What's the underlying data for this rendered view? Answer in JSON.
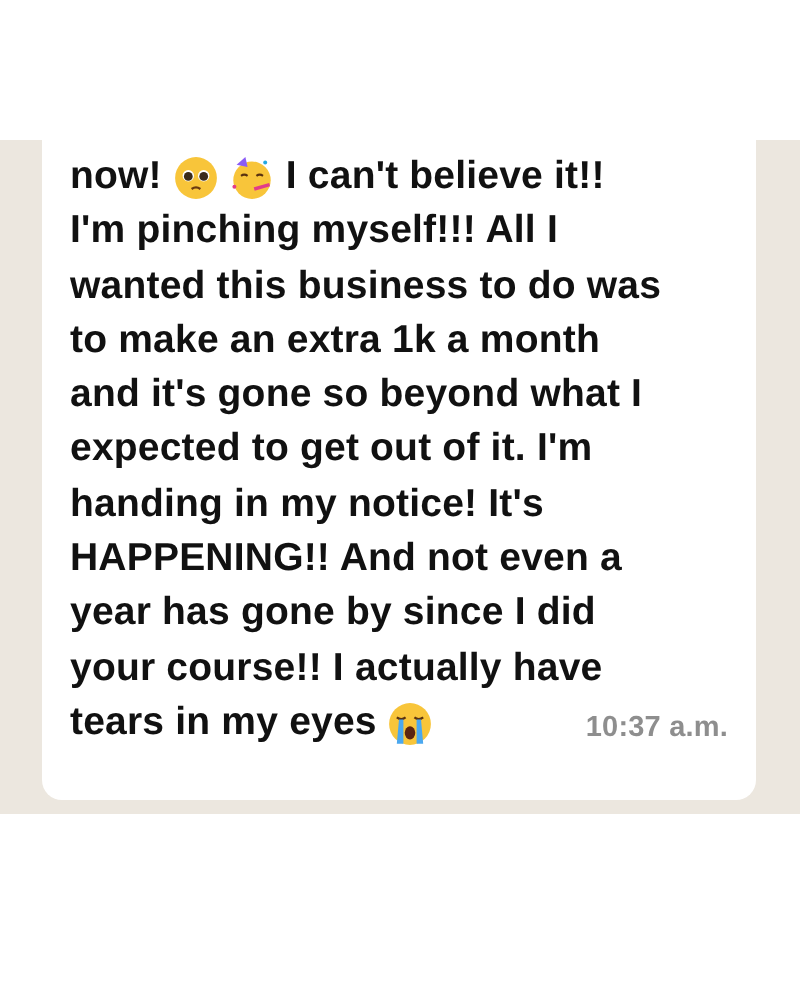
{
  "message": {
    "rows": [
      {
        "segments": [
          {
            "kind": "text",
            "lines": [
              "now!"
            ]
          },
          {
            "kind": "pleading"
          },
          {
            "kind": "party"
          },
          {
            "kind": "text",
            "lines": [
              "I can't believe it!!"
            ]
          }
        ]
      },
      {
        "segments": [
          {
            "kind": "text",
            "lines": [
              "I'm pinching myself!!! All I",
              "wanted this business to do was",
              "to make an extra 1k a month",
              "and it's gone so beyond what I",
              "expected to get out of it. I'm",
              "handing in my notice! It's",
              "HAPPENING!! And not even a",
              "year has gone by since I did",
              "your course!! I actually have"
            ]
          }
        ]
      },
      {
        "segments": [
          {
            "kind": "text",
            "lines": [
              "tears in my eyes"
            ]
          },
          {
            "kind": "crying"
          }
        ]
      }
    ],
    "time": "10:37 a.m."
  }
}
